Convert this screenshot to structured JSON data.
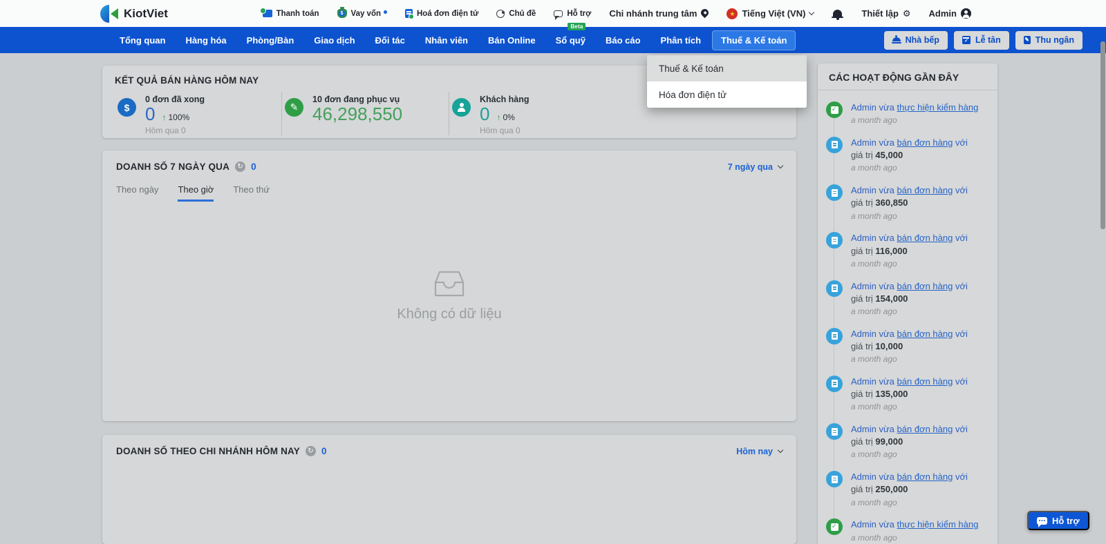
{
  "colors": {
    "navbar_blue": "#0d53cf",
    "nav_active_bg": "#2c79e6",
    "accent_blue": "#1b62d6",
    "positive_green": "#2f9e46",
    "stat_teal": "#16a398",
    "support_button_blue": "#0d57d6"
  },
  "topbar": {
    "brand": "KiotViet",
    "links": [
      {
        "label": "Thanh toán",
        "icon": "payment-icon"
      },
      {
        "label": "Vay vốn",
        "icon": "loan-icon"
      },
      {
        "label": "Hoá đơn điện tử",
        "icon": "e-invoice-icon"
      },
      {
        "label": "Chủ đề",
        "icon": "theme-icon"
      },
      {
        "label": "Hỗ trợ",
        "icon": "support-icon",
        "badge": "Beta"
      }
    ],
    "branch": "Chi nhánh trung tâm",
    "language": "Tiếng Việt (VN)",
    "settings_label": "Thiết lập",
    "user": "Admin"
  },
  "navbar": {
    "items": [
      "Tổng quan",
      "Hàng hóa",
      "Phòng/Bàn",
      "Giao dịch",
      "Đối tác",
      "Nhân viên",
      "Bán Online",
      "Sổ quỹ",
      "Báo cáo",
      "Phân tích",
      "Thuế & Kế toán"
    ],
    "active_item": "Thuế & Kế toán",
    "quick_buttons": [
      "Nhà bếp",
      "Lễ tân",
      "Thu ngân"
    ]
  },
  "dropdown_menu": {
    "items": [
      "Thuế & Kế toán",
      "Hóa đơn điện tử"
    ]
  },
  "sales_today": {
    "title": "KẾT QUẢ BÁN HÀNG HÔM NAY",
    "stats": [
      {
        "label": "0 đơn đã xong",
        "value": "0",
        "delta": "100%",
        "sub": "Hôm qua 0"
      },
      {
        "label": "10 đơn đang phục vụ",
        "value": "46,298,550"
      },
      {
        "label": "Khách hàng",
        "value": "0",
        "delta": "0%",
        "sub": "Hôm qua 0"
      }
    ]
  },
  "sales_week": {
    "title": "DOANH SỐ 7 NGÀY QUA",
    "count": "0",
    "range": "7 ngày qua",
    "tabs": [
      "Theo ngày",
      "Theo giờ",
      "Theo thứ"
    ],
    "active_tab": "Theo giờ",
    "empty_text": "Không có dữ liệu"
  },
  "sales_branch": {
    "title": "DOANH SỐ THEO CHI NHÁNH HÔM NAY",
    "count": "0",
    "range": "Hôm nay"
  },
  "activities": {
    "title": "CÁC HOẠT ĐỘNG GẦN ĐÂY",
    "items": [
      {
        "type": "check",
        "prefix": "Admin vừa",
        "link": "thực hiện kiểm hàng",
        "time": "a month ago"
      },
      {
        "type": "invoice",
        "prefix": "Admin vừa",
        "link": "bán đơn hàng",
        "suffix": "với",
        "value_label": "giá trị",
        "value": "45,000",
        "time": "a month ago"
      },
      {
        "type": "invoice",
        "prefix": "Admin vừa",
        "link": "bán đơn hàng",
        "suffix": "với",
        "value_label": "giá trị",
        "value": "360,850",
        "time": "a month ago"
      },
      {
        "type": "invoice",
        "prefix": "Admin vừa",
        "link": "bán đơn hàng",
        "suffix": "với",
        "value_label": "giá trị",
        "value": "116,000",
        "time": "a month ago"
      },
      {
        "type": "invoice",
        "prefix": "Admin vừa",
        "link": "bán đơn hàng",
        "suffix": "với",
        "value_label": "giá trị",
        "value": "154,000",
        "time": "a month ago"
      },
      {
        "type": "invoice",
        "prefix": "Admin vừa",
        "link": "bán đơn hàng",
        "suffix": "với",
        "value_label": "giá trị",
        "value": "10,000",
        "time": "a month ago"
      },
      {
        "type": "invoice",
        "prefix": "Admin vừa",
        "link": "bán đơn hàng",
        "suffix": "với",
        "value_label": "giá trị",
        "value": "135,000",
        "time": "a month ago"
      },
      {
        "type": "invoice",
        "prefix": "Admin vừa",
        "link": "bán đơn hàng",
        "suffix": "với",
        "value_label": "giá trị",
        "value": "99,000",
        "time": "a month ago"
      },
      {
        "type": "invoice",
        "prefix": "Admin vừa",
        "link": "bán đơn hàng",
        "suffix": "với",
        "value_label": "giá trị",
        "value": "250,000",
        "time": "a month ago"
      },
      {
        "type": "check",
        "prefix": "Admin vừa",
        "link": "thực hiện kiểm hàng",
        "time": "a month ago"
      }
    ]
  },
  "support_button": {
    "label": "Hỗ trợ"
  }
}
